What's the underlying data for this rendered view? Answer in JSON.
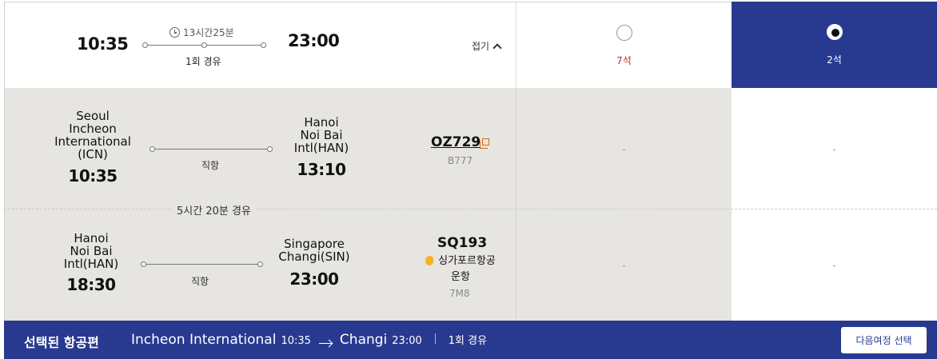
{
  "summary": {
    "depart_time": "10:35",
    "arrive_time": "23:00",
    "duration": "13시간25분",
    "stops": "1회 경유",
    "collapse_label": "접기"
  },
  "fares": [
    {
      "seats": "7석",
      "selected": false
    },
    {
      "seats": "2석",
      "selected": true
    }
  ],
  "segments": [
    {
      "origin": "Seoul\nIncheon\nInternational\n(ICN)",
      "depart_time": "10:35",
      "destination": "Hanoi\nNoi Bai\nIntl(HAN)",
      "arrive_time": "13:10",
      "direct_label": "직항",
      "flight_no": "OZ729",
      "aircraft": "B777",
      "fare_cells": [
        "-",
        "-"
      ]
    },
    {
      "origin": "Hanoi\nNoi Bai\nIntl(HAN)",
      "depart_time": "18:30",
      "destination": "Singapore\nChangi(SIN)",
      "arrive_time": "23:00",
      "direct_label": "직항",
      "flight_no": "SQ193",
      "operator": "싱가포르항공",
      "operated_label": "운항",
      "aircraft": "7M8",
      "fare_cells": [
        "-",
        "-"
      ]
    }
  ],
  "layover": "5시간 20분 경유",
  "bottom_bar": {
    "title": "선택된 항공편",
    "from_airport": "Incheon International",
    "from_time": "10:35",
    "to_airport": "Changi",
    "to_time": "23:00",
    "stops": "1회 경유",
    "next_button": "다음여정 선택"
  },
  "colors": {
    "brand_navy": "#283a8f",
    "seat_warning_red": "#c62828",
    "detail_bg": "#e7e5e1",
    "airline_icon": "#f3b223"
  }
}
